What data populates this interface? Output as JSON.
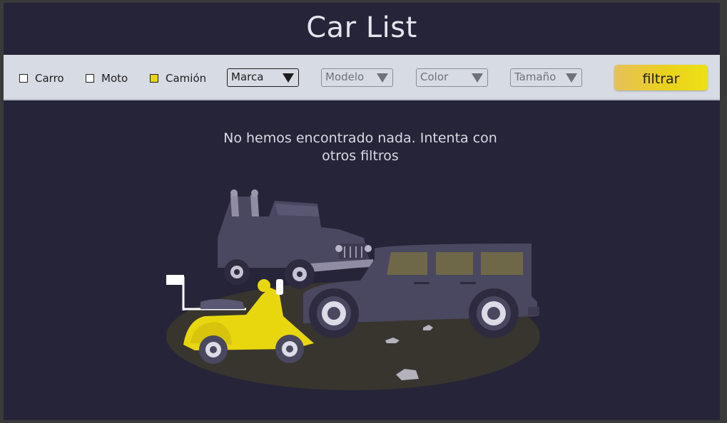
{
  "header": {
    "title": "Car List"
  },
  "filters": {
    "checkboxes": [
      {
        "label": "Carro",
        "checked": false
      },
      {
        "label": "Moto",
        "checked": false
      },
      {
        "label": "Camión",
        "checked": true
      }
    ],
    "selects": [
      {
        "label": "Marca",
        "active": true
      },
      {
        "label": "Modelo",
        "active": false
      },
      {
        "label": "Color",
        "active": false
      },
      {
        "label": "Tamaño",
        "active": false
      }
    ],
    "submit_label": "filtrar"
  },
  "empty_state": {
    "message_line1": "No hemos encontrado nada. Intenta con",
    "message_line2": "otros filtros",
    "illustration": "vehicles-jeep-suv-scooter"
  },
  "colors": {
    "background": "#262438",
    "toolbar": "#d7dbe3",
    "accent_yellow": "#e8d70f",
    "vehicle_dark": "#4a4760"
  }
}
